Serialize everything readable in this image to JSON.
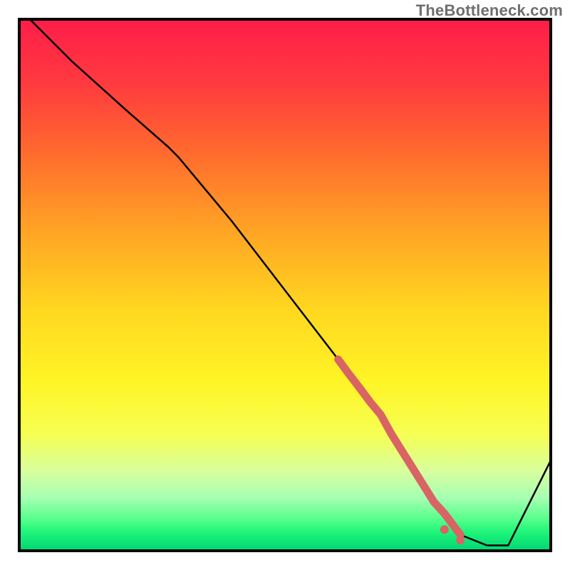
{
  "watermark": "TheBottleneck.com",
  "chart_data": {
    "type": "line",
    "title": "",
    "xlabel": "",
    "ylabel": "",
    "xlim": [
      0,
      100
    ],
    "ylim": [
      0,
      100
    ],
    "grid": false,
    "legend": false,
    "background": {
      "kind": "vertical-gradient",
      "stops": [
        {
          "pos": 0.0,
          "color": "#ff1d49"
        },
        {
          "pos": 0.12,
          "color": "#ff3a3f"
        },
        {
          "pos": 0.25,
          "color": "#ff6a2e"
        },
        {
          "pos": 0.4,
          "color": "#ffa524"
        },
        {
          "pos": 0.55,
          "color": "#ffd820"
        },
        {
          "pos": 0.68,
          "color": "#fff425"
        },
        {
          "pos": 0.78,
          "color": "#f6ff52"
        },
        {
          "pos": 0.85,
          "color": "#d8ff9e"
        },
        {
          "pos": 0.9,
          "color": "#a6ffb2"
        },
        {
          "pos": 0.94,
          "color": "#57ff8c"
        },
        {
          "pos": 0.965,
          "color": "#1ff47a"
        },
        {
          "pos": 1.0,
          "color": "#00d672"
        }
      ]
    },
    "series": [
      {
        "name": "bottleneck-curve",
        "color": "#000000",
        "x": [
          2,
          10,
          20,
          28,
          30,
          40,
          50,
          60,
          66,
          70,
          75,
          80,
          83,
          88,
          92,
          100
        ],
        "y": [
          100,
          92,
          83,
          76,
          74,
          62,
          49,
          36,
          28,
          22,
          14,
          7,
          3,
          1,
          1,
          17
        ]
      }
    ],
    "highlight": {
      "name": "highlighted-segment",
      "color": "#d86464",
      "points_x": [
        60,
        62,
        64,
        66,
        68,
        70,
        72,
        74,
        76,
        78,
        80,
        83
      ],
      "points_y": [
        36,
        33.3,
        30.7,
        28,
        25.6,
        22,
        18.8,
        15.6,
        12.4,
        9.2,
        7,
        3
      ],
      "extra_dots_x": [
        80,
        83
      ],
      "extra_dots_y": [
        4,
        2
      ]
    },
    "frame": {
      "stroke": "#000000",
      "stroke_width": 4
    }
  }
}
